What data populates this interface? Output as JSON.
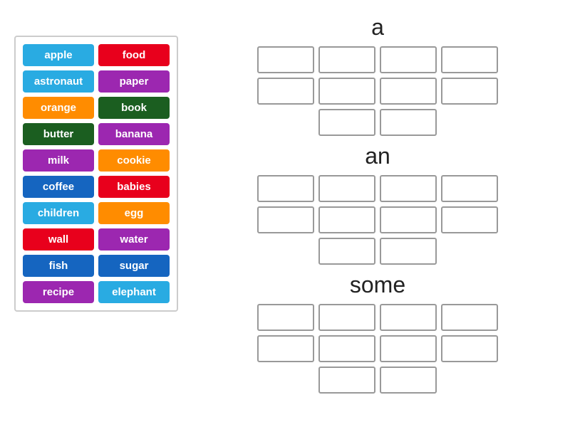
{
  "wordBank": {
    "items": [
      {
        "label": "apple",
        "color": "#29ABE2"
      },
      {
        "label": "food",
        "color": "#E8001C"
      },
      {
        "label": "astronaut",
        "color": "#29ABE2"
      },
      {
        "label": "paper",
        "color": "#9C27B0"
      },
      {
        "label": "orange",
        "color": "#FF8C00"
      },
      {
        "label": "book",
        "color": "#1B5E20"
      },
      {
        "label": "butter",
        "color": "#1B5E20"
      },
      {
        "label": "banana",
        "color": "#9C27B0"
      },
      {
        "label": "milk",
        "color": "#9C27B0"
      },
      {
        "label": "cookie",
        "color": "#FF8C00"
      },
      {
        "label": "coffee",
        "color": "#1565C0"
      },
      {
        "label": "babies",
        "color": "#E8001C"
      },
      {
        "label": "children",
        "color": "#29ABE2"
      },
      {
        "label": "egg",
        "color": "#FF8C00"
      },
      {
        "label": "wall",
        "color": "#E8001C"
      },
      {
        "label": "water",
        "color": "#9C27B0"
      },
      {
        "label": "fish",
        "color": "#1565C0"
      },
      {
        "label": "sugar",
        "color": "#1565C0"
      },
      {
        "label": "recipe",
        "color": "#9C27B0"
      },
      {
        "label": "elephant",
        "color": "#29ABE2"
      }
    ]
  },
  "categories": [
    {
      "title": "a",
      "rows": 2,
      "cols": 4,
      "extraRow": 2
    },
    {
      "title": "an",
      "rows": 2,
      "cols": 4,
      "extraRow": 2
    },
    {
      "title": "some",
      "rows": 2,
      "cols": 4,
      "extraRow": 2
    }
  ]
}
